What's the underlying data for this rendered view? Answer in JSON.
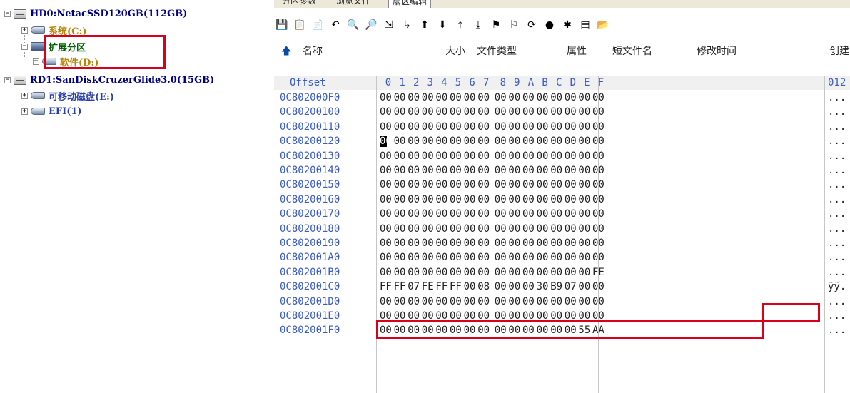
{
  "tree": {
    "nodes": [
      {
        "id": "hd0",
        "label": "HD0:NetacSSD120GB(112GB)",
        "color": "#000080",
        "expander": "⊟",
        "icon": "disk-icon"
      },
      {
        "id": "sys",
        "label": "系统(C:)",
        "color": "#b8860b",
        "expander": "⊞",
        "icon": "partition-icon"
      },
      {
        "id": "ext",
        "label": "扩展分区",
        "color": "#006400",
        "expander": "⊟",
        "icon": "extended-partition-icon"
      },
      {
        "id": "soft",
        "label": "软件(D:)",
        "color": "#b8860b",
        "expander": "⊞",
        "icon": "partition-icon"
      },
      {
        "id": "rd1",
        "label": "RD1:SanDiskCruzerGlide3.0(15GB)",
        "color": "#000080",
        "expander": "⊟",
        "icon": "disk-icon"
      },
      {
        "id": "rem",
        "label": "可移动磁盘(E:)",
        "color": "#2b3fa8",
        "expander": "⊞",
        "icon": "partition-icon"
      },
      {
        "id": "efi",
        "label": "EFI(1)",
        "color": "#2b3fa8",
        "expander": "⊞",
        "icon": "partition-icon"
      }
    ]
  },
  "tabs": [
    "分区参数",
    "浏览文件",
    "扇区编辑"
  ],
  "toolbar": {
    "icons": [
      "save-icon",
      "copy-icon",
      "paste-icon",
      "undo-icon",
      "search-icon",
      "find-next-icon",
      "goto-icon",
      "jump-icon",
      "up-icon",
      "down-icon",
      "first-icon",
      "last-icon",
      "mark-start-icon",
      "mark-end-icon",
      "refresh-icon",
      "pie-icon",
      "puzzle-icon",
      "file-icon",
      "folder-icon"
    ],
    "glyphs": [
      "💾",
      "📋",
      "📄",
      "↶",
      "🔍",
      "🔎",
      "⇲",
      "↳",
      "⬆",
      "⬇",
      "⤒",
      "⤓",
      "⚑",
      "⚐",
      "⟳",
      "●",
      "✱",
      "▤",
      "📂"
    ]
  },
  "columns": {
    "up_glyph": "🡅",
    "name": "名称",
    "size": "大小",
    "type": "文件类型",
    "attr": "属性",
    "short": "短文件名",
    "mtime": "修改时间",
    "ctime": "创建"
  },
  "hex": {
    "header": {
      "offset": "Offset",
      "cols": [
        "0",
        "1",
        "2",
        "3",
        "4",
        "5",
        "6",
        "7",
        "8",
        "9",
        "A",
        "B",
        "C",
        "D",
        "E",
        "F"
      ],
      "ascii": "012"
    },
    "rows": [
      {
        "offset": "0C802000F0",
        "bytes": [
          "00",
          "00",
          "00",
          "00",
          "00",
          "00",
          "00",
          "00",
          "00",
          "00",
          "00",
          "00",
          "00",
          "00",
          "00",
          "00"
        ],
        "ascii": "..."
      },
      {
        "offset": "0C80200100",
        "bytes": [
          "00",
          "00",
          "00",
          "00",
          "00",
          "00",
          "00",
          "00",
          "00",
          "00",
          "00",
          "00",
          "00",
          "00",
          "00",
          "00"
        ],
        "ascii": "..."
      },
      {
        "offset": "0C80200110",
        "bytes": [
          "00",
          "00",
          "00",
          "00",
          "00",
          "00",
          "00",
          "00",
          "00",
          "00",
          "00",
          "00",
          "00",
          "00",
          "00",
          "00"
        ],
        "ascii": "..."
      },
      {
        "offset": "0C80200120",
        "bytes": [
          "00",
          "00",
          "00",
          "00",
          "00",
          "00",
          "00",
          "00",
          "00",
          "00",
          "00",
          "00",
          "00",
          "00",
          "00",
          "00"
        ],
        "ascii": "..."
      },
      {
        "offset": "0C80200130",
        "bytes": [
          "00",
          "00",
          "00",
          "00",
          "00",
          "00",
          "00",
          "00",
          "00",
          "00",
          "00",
          "00",
          "00",
          "00",
          "00",
          "00"
        ],
        "ascii": "..."
      },
      {
        "offset": "0C80200140",
        "bytes": [
          "00",
          "00",
          "00",
          "00",
          "00",
          "00",
          "00",
          "00",
          "00",
          "00",
          "00",
          "00",
          "00",
          "00",
          "00",
          "00"
        ],
        "ascii": "..."
      },
      {
        "offset": "0C80200150",
        "bytes": [
          "00",
          "00",
          "00",
          "00",
          "00",
          "00",
          "00",
          "00",
          "00",
          "00",
          "00",
          "00",
          "00",
          "00",
          "00",
          "00"
        ],
        "ascii": "..."
      },
      {
        "offset": "0C80200160",
        "bytes": [
          "00",
          "00",
          "00",
          "00",
          "00",
          "00",
          "00",
          "00",
          "00",
          "00",
          "00",
          "00",
          "00",
          "00",
          "00",
          "00"
        ],
        "ascii": "..."
      },
      {
        "offset": "0C80200170",
        "bytes": [
          "00",
          "00",
          "00",
          "00",
          "00",
          "00",
          "00",
          "00",
          "00",
          "00",
          "00",
          "00",
          "00",
          "00",
          "00",
          "00"
        ],
        "ascii": "..."
      },
      {
        "offset": "0C80200180",
        "bytes": [
          "00",
          "00",
          "00",
          "00",
          "00",
          "00",
          "00",
          "00",
          "00",
          "00",
          "00",
          "00",
          "00",
          "00",
          "00",
          "00"
        ],
        "ascii": "..."
      },
      {
        "offset": "0C80200190",
        "bytes": [
          "00",
          "00",
          "00",
          "00",
          "00",
          "00",
          "00",
          "00",
          "00",
          "00",
          "00",
          "00",
          "00",
          "00",
          "00",
          "00"
        ],
        "ascii": "..."
      },
      {
        "offset": "0C802001A0",
        "bytes": [
          "00",
          "00",
          "00",
          "00",
          "00",
          "00",
          "00",
          "00",
          "00",
          "00",
          "00",
          "00",
          "00",
          "00",
          "00",
          "00"
        ],
        "ascii": "..."
      },
      {
        "offset": "0C802001B0",
        "bytes": [
          "00",
          "00",
          "00",
          "00",
          "00",
          "00",
          "00",
          "00",
          "00",
          "00",
          "00",
          "00",
          "00",
          "00",
          "00",
          "FE"
        ],
        "ascii": "..."
      },
      {
        "offset": "0C802001C0",
        "bytes": [
          "FF",
          "FF",
          "07",
          "FE",
          "FF",
          "FF",
          "00",
          "08",
          "00",
          "00",
          "00",
          "30",
          "B9",
          "07",
          "00",
          "00"
        ],
        "ascii": "ÿÿ."
      },
      {
        "offset": "0C802001D0",
        "bytes": [
          "00",
          "00",
          "00",
          "00",
          "00",
          "00",
          "00",
          "00",
          "00",
          "00",
          "00",
          "00",
          "00",
          "00",
          "00",
          "00"
        ],
        "ascii": "..."
      },
      {
        "offset": "0C802001E0",
        "bytes": [
          "00",
          "00",
          "00",
          "00",
          "00",
          "00",
          "00",
          "00",
          "00",
          "00",
          "00",
          "00",
          "00",
          "00",
          "00",
          "00"
        ],
        "ascii": "..."
      },
      {
        "offset": "0C802001F0",
        "bytes": [
          "00",
          "00",
          "00",
          "00",
          "00",
          "00",
          "00",
          "00",
          "00",
          "00",
          "00",
          "00",
          "00",
          "00",
          "55",
          "AA"
        ],
        "ascii": "..."
      }
    ],
    "caret": {
      "row": 3,
      "col": 0
    }
  },
  "colors": {
    "highlight_red": "#d9001b",
    "offset_blue": "#3a5cc4"
  }
}
